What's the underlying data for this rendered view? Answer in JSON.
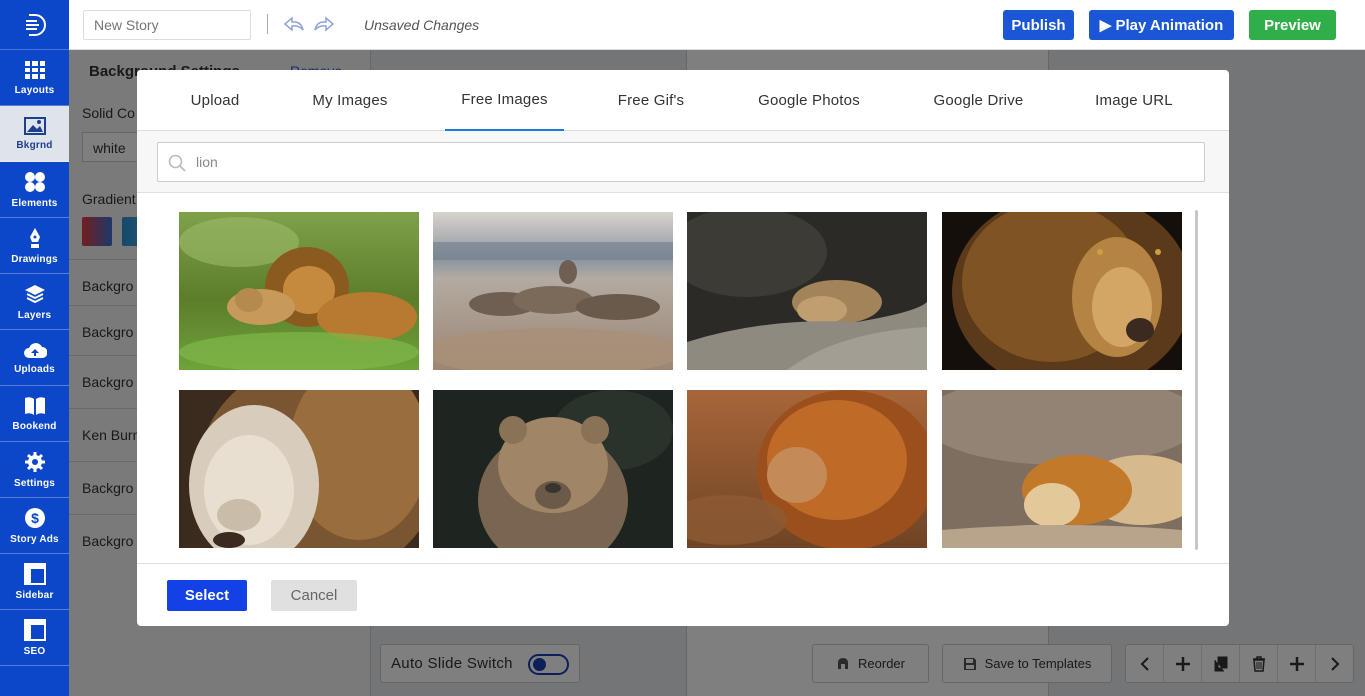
{
  "sidebar": {
    "items": [
      {
        "label": "Layouts",
        "icon": "layouts-icon"
      },
      {
        "label": "Bkgrnd",
        "icon": "image-icon"
      },
      {
        "label": "Elements",
        "icon": "elements-icon"
      },
      {
        "label": "Drawings",
        "icon": "pen-icon"
      },
      {
        "label": "Layers",
        "icon": "layers-icon"
      },
      {
        "label": "Uploads",
        "icon": "cloud-upload-icon"
      },
      {
        "label": "Bookend",
        "icon": "book-icon"
      },
      {
        "label": "Settings",
        "icon": "gear-icon"
      },
      {
        "label": "Story Ads",
        "icon": "dollar-icon"
      },
      {
        "label": "Sidebar",
        "icon": "sidebar-icon"
      },
      {
        "label": "SEO",
        "icon": "seo-icon"
      }
    ],
    "active_index": 1
  },
  "topbar": {
    "story_name_placeholder": "New Story",
    "status": "Unsaved Changes",
    "publish": "Publish",
    "play": "▶ Play Animation",
    "preview": "Preview"
  },
  "settings": {
    "title": "Background Settings",
    "remove": "Remove",
    "solid_label": "Solid Co",
    "solid_value": "white",
    "gradient_label": "Gradient",
    "rows": [
      "Backgro",
      "Backgro",
      "Backgro",
      "Ken Burn",
      "Backgro",
      "Backgro"
    ]
  },
  "bottom": {
    "auto_slide": "Auto Slide Switch",
    "reorder": "Reorder",
    "save_templates": "Save to Templates"
  },
  "modal": {
    "tabs": [
      "Upload",
      "My Images",
      "Free Images",
      "Free Gif's",
      "Google Photos",
      "Google Drive",
      "Image URL"
    ],
    "active_tab": "Free Images",
    "search_value": "lion",
    "select": "Select",
    "cancel": "Cancel"
  },
  "colors": {
    "sidebar": "#0d47c9",
    "publish": "#1a56d6",
    "preview": "#2fae4a",
    "select": "#1441e6",
    "active_tab_underline": "#1a7be0"
  }
}
